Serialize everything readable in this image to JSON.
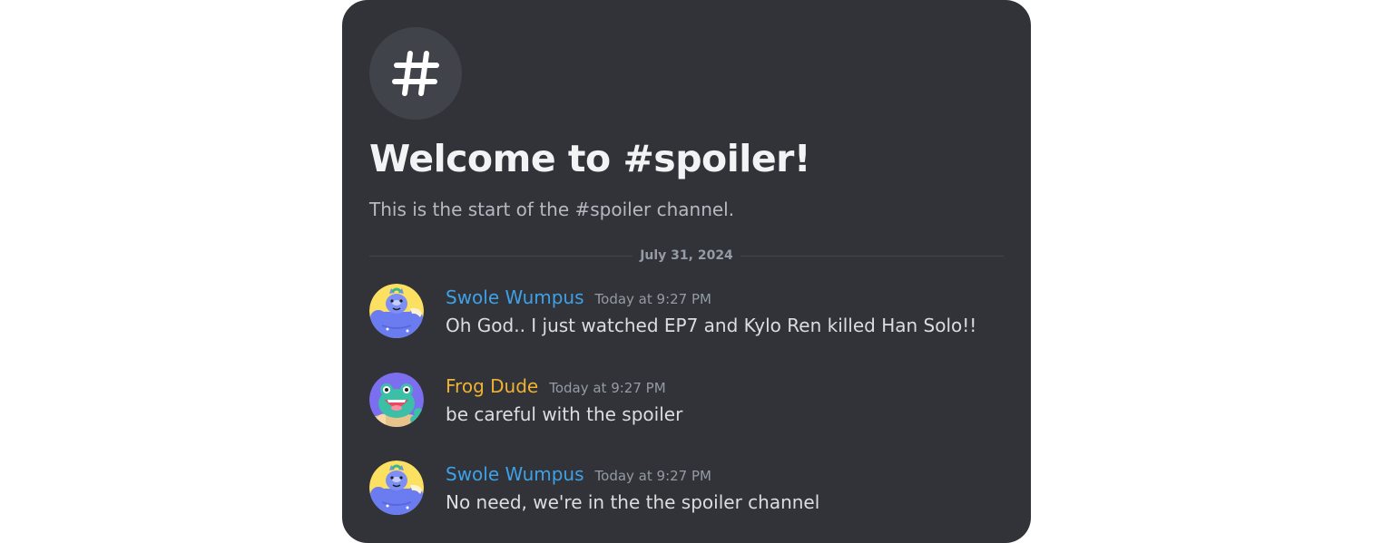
{
  "channel": {
    "icon": "hash-icon",
    "welcome_title": "Welcome to #spoiler!",
    "welcome_subtitle": "This is the start of the #spoiler channel."
  },
  "date_divider": "July 31, 2024",
  "messages": [
    {
      "author": "Swole Wumpus",
      "author_color": "#3ea1e8",
      "timestamp": "Today at 9:27 PM",
      "text": "Oh God.. I just watched EP7 and Kylo Ren killed Han Solo!!",
      "avatar": "wumpus-avatar"
    },
    {
      "author": "Frog Dude",
      "author_color": "#f0b232",
      "timestamp": "Today at 9:27 PM",
      "text": "be careful with the spoiler",
      "avatar": "frog-avatar"
    },
    {
      "author": "Swole Wumpus",
      "author_color": "#3ea1e8",
      "timestamp": "Today at 9:27 PM",
      "text": "No need, we're in the the spoiler channel",
      "avatar": "wumpus-avatar"
    }
  ],
  "colors": {
    "panel_bg": "#313338",
    "icon_bg": "#41434a"
  }
}
